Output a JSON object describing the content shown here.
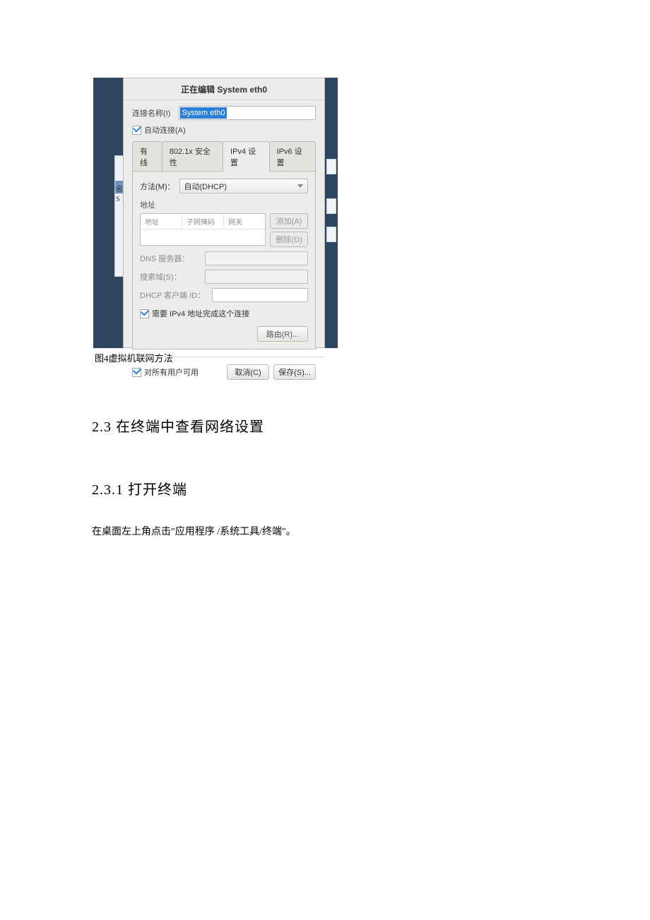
{
  "dialog": {
    "title": "正在编辑 System eth0",
    "conn_name_label": "连接名称(I)",
    "conn_name_value": "System eth0",
    "auto_connect": "自动连接(A)",
    "tabs": {
      "wired": "有线",
      "security": "802.1x 安全性",
      "ipv4": "IPv4 设置",
      "ipv6": "IPv6 设置"
    },
    "method_label": "方法(M)：",
    "method_value": "自动(DHCP)",
    "address_section": "地址",
    "addr_headers": {
      "addr": "地址",
      "mask": "子网掩码",
      "gw": "网关"
    },
    "add_btn": "添加(A)",
    "del_btn": "删除(D)",
    "dns_label": "DNS 服务器：",
    "search_label": "搜索域(S)：",
    "dhcp_label": "DHCP 客户端 ID：",
    "require_ipv4": "需要 IPv4 地址完成这个连接",
    "routes_btn": "路由(R)...",
    "all_users": "对所有用户可用",
    "cancel": "取消(C)",
    "save": "保存(S)..."
  },
  "caption": "图4虚拟机联网方法",
  "heading_23": "2.3 在终端中查看网络设置",
  "heading_231": "2.3.1 打开终端",
  "paragraph": "在桌面左上角点击\"应用程序 /系统工具/终端\"。",
  "left_stripe": {
    "a": "名",
    "b": "S"
  }
}
